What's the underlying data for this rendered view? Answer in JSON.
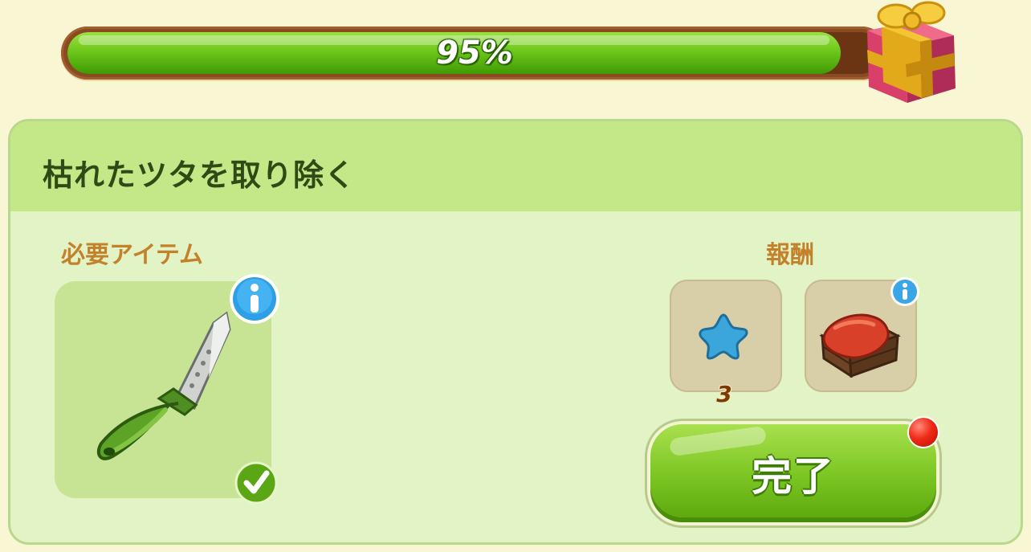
{
  "progress": {
    "percent": 95,
    "label": "95%",
    "reward_icon": "gift-box-icon"
  },
  "task": {
    "title": "枯れたツタを取り除く",
    "required_label": "必要アイテム",
    "required_item": {
      "icon": "knife-icon",
      "owned": true
    },
    "reward_label": "報酬",
    "rewards": [
      {
        "icon": "blue-star-icon",
        "count": "3"
      },
      {
        "icon": "wooden-crate-red-cloth-icon",
        "count": ""
      }
    ],
    "done_button": "完了"
  },
  "colors": {
    "accent_green": "#7ec724",
    "label_orange": "#c4812b",
    "notification_red": "#f02a18"
  }
}
